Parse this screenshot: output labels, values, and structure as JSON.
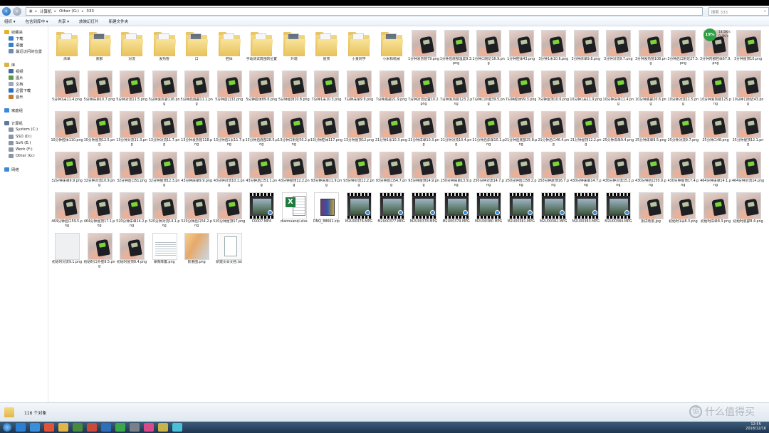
{
  "address": {
    "crumbs": [
      "计算机",
      "Other (G:)",
      "333"
    ]
  },
  "search": {
    "placeholder": "搜索 333"
  },
  "toolbar": {
    "items": [
      "组织 ▾",
      "包含到库中 ▾",
      "共享 ▾",
      "放映幻灯片",
      "新建文件夹"
    ]
  },
  "sidebar": {
    "items": [
      {
        "label": "收藏夹",
        "icon": "star-icon",
        "indent": 0
      },
      {
        "label": "下载",
        "icon": "download-icon",
        "indent": 1
      },
      {
        "label": "桌面",
        "icon": "desktop-icon",
        "indent": 1
      },
      {
        "label": "最近访问的位置",
        "icon": "recent-icon",
        "indent": 1
      },
      {
        "label": "",
        "icon": "",
        "indent": 0
      },
      {
        "label": "库",
        "icon": "library-icon",
        "indent": 0
      },
      {
        "label": "视频",
        "icon": "video-icon",
        "indent": 1
      },
      {
        "label": "图片",
        "icon": "picture-icon",
        "indent": 1
      },
      {
        "label": "文档",
        "icon": "document-icon",
        "indent": 1
      },
      {
        "label": "迅雷下载",
        "icon": "thunder-icon",
        "indent": 1
      },
      {
        "label": "音乐",
        "icon": "music-icon",
        "indent": 1
      },
      {
        "label": "",
        "icon": "",
        "indent": 0
      },
      {
        "label": "家庭组",
        "icon": "homegroup-icon",
        "indent": 0
      },
      {
        "label": "",
        "icon": "",
        "indent": 0
      },
      {
        "label": "计算机",
        "icon": "computer-icon",
        "indent": 0
      },
      {
        "label": "System (C:)",
        "icon": "drive-icon",
        "indent": 1
      },
      {
        "label": "SSD (D:)",
        "icon": "drive-icon",
        "indent": 1
      },
      {
        "label": "Soft (E:)",
        "icon": "drive-icon",
        "indent": 1
      },
      {
        "label": "Work (F:)",
        "icon": "drive-icon",
        "indent": 1
      },
      {
        "label": "Other (G:)",
        "icon": "drive-icon",
        "indent": 1
      },
      {
        "label": "",
        "icon": "",
        "indent": 0
      },
      {
        "label": "网络",
        "icon": "network-icon",
        "indent": 0
      }
    ]
  },
  "files": [
    {
      "label": "床单",
      "kind": "folder"
    },
    {
      "label": "底部",
      "kind": "folder"
    },
    {
      "label": "对流",
      "kind": "folder"
    },
    {
      "label": "发热管",
      "kind": "folder"
    },
    {
      "label": "口",
      "kind": "folder"
    },
    {
      "label": "腔体",
      "kind": "folder"
    },
    {
      "label": "手动测试周围的位置",
      "kind": "folder"
    },
    {
      "label": "外观",
      "kind": "folder"
    },
    {
      "label": "屋顶",
      "kind": "folder"
    },
    {
      "label": "小爱同学",
      "kind": "folder"
    },
    {
      "label": "小米和机械",
      "kind": "folder"
    },
    {
      "label": "1分钟发热管79.png",
      "kind": "photo"
    },
    {
      "label": "1分钟后底部温度9.3.png",
      "kind": "photo"
    },
    {
      "label": "1分钟口附近16.9.png",
      "kind": "photo"
    },
    {
      "label": "1分钟腔体43.png",
      "kind": "photo"
    },
    {
      "label": "3分钟1米10.6.png",
      "kind": "photo"
    },
    {
      "label": "3分钟床单9.8.png",
      "kind": "photo"
    },
    {
      "label": "3分钟对流9.7.png",
      "kind": "photo"
    },
    {
      "label": "3分钟发热管108.png",
      "kind": "photo"
    },
    {
      "label": "3分钟后口附近27.5.png",
      "kind": "photo"
    },
    {
      "label": "3分钟内部腔体67.9.png",
      "kind": "photo"
    },
    {
      "label": "3分钟屋顶10.png",
      "kind": "photo"
    },
    {
      "label": "5分钟1米11.4.png",
      "kind": "photo"
    },
    {
      "label": "5分钟床单10.7.png",
      "kind": "photo"
    },
    {
      "label": "5分钟对流11.5.png",
      "kind": "photo"
    },
    {
      "label": "5分钟发热管116.png",
      "kind": "photo"
    },
    {
      "label": "5分钟后底部11.1.png",
      "kind": "photo"
    },
    {
      "label": "5分钟后口32.png",
      "kind": "photo"
    },
    {
      "label": "5分钟腔体89.6.png",
      "kind": "photo"
    },
    {
      "label": "5分钟屋顶10.8.png",
      "kind": "photo"
    },
    {
      "label": "7分钟1米10.3.png",
      "kind": "photo"
    },
    {
      "label": "7分钟床单9.9.png",
      "kind": "photo"
    },
    {
      "label": "7分钟底部21.9.png",
      "kind": "photo"
    },
    {
      "label": "7分钟对流位置10.2.png",
      "kind": "photo"
    },
    {
      "label": "7分钟发热管123.2.png",
      "kind": "photo"
    },
    {
      "label": "7分钟口外壁39.5.png",
      "kind": "photo"
    },
    {
      "label": "7分钟腔体99.3.png",
      "kind": "photo"
    },
    {
      "label": "7分钟屋顶10.6.png",
      "kind": "photo"
    },
    {
      "label": "10分钟1米11.9.png",
      "kind": "photo"
    },
    {
      "label": "10分钟床单11.4.png",
      "kind": "photo"
    },
    {
      "label": "10分钟底部20.6.png",
      "kind": "photo"
    },
    {
      "label": "10分钟对流11.5.png",
      "kind": "photo"
    },
    {
      "label": "10分钟发热管125.png",
      "kind": "photo"
    },
    {
      "label": "10分钟口附近43.png",
      "kind": "photo"
    },
    {
      "label": "10分钟腔体110.png",
      "kind": "photo"
    },
    {
      "label": "10分钟屋顶12.5.png",
      "kind": "photo"
    },
    {
      "label": "13分钟对流11.3.png",
      "kind": "photo"
    },
    {
      "label": "13分钟对流11.7.png",
      "kind": "photo"
    },
    {
      "label": "13分钟发热管118.png",
      "kind": "photo"
    },
    {
      "label": "13分钟后1米11.7.png",
      "kind": "photo"
    },
    {
      "label": "13分钟后底部28.5.png",
      "kind": "photo"
    },
    {
      "label": "13分钟口附近50.2.png",
      "kind": "photo"
    },
    {
      "label": "13分钟腔体117.png",
      "kind": "photo"
    },
    {
      "label": "13分钟屋顶12.png",
      "kind": "photo"
    },
    {
      "label": "21分钟1米10.3.png",
      "kind": "photo"
    },
    {
      "label": "21分钟床单10.3.png",
      "kind": "photo"
    },
    {
      "label": "21分钟对流10.4.png",
      "kind": "photo"
    },
    {
      "label": "21分钟后床单10.1.png",
      "kind": "photo"
    },
    {
      "label": "21分钟后底部25.8.png",
      "kind": "photo"
    },
    {
      "label": "21分钟后口46.4.png",
      "kind": "photo"
    },
    {
      "label": "21分钟屋顶12.2.png",
      "kind": "photo"
    },
    {
      "label": "25分钟床单9.4.png",
      "kind": "photo"
    },
    {
      "label": "25分钟床单9.5.png",
      "kind": "photo"
    },
    {
      "label": "25分钟对流9.7.png",
      "kind": "photo"
    },
    {
      "label": "25分钟口48.png",
      "kind": "photo"
    },
    {
      "label": "25分钟屋顶12.1.png",
      "kind": "photo"
    },
    {
      "label": "32分钟床单9.9.png",
      "kind": "photo"
    },
    {
      "label": "32分钟对流10.9.png",
      "kind": "photo"
    },
    {
      "label": "32分钟后口51.png",
      "kind": "photo"
    },
    {
      "label": "32分钟屋顶12.3.png",
      "kind": "photo"
    },
    {
      "label": "43分钟床单9.9.png",
      "kind": "photo"
    },
    {
      "label": "43分钟对流10.1.png",
      "kind": "photo"
    },
    {
      "label": "43分钟后口51.1.png",
      "kind": "photo"
    },
    {
      "label": "43分钟屋顶12.2.png",
      "kind": "photo"
    },
    {
      "label": "93分钟床单11.9.png",
      "kind": "photo"
    },
    {
      "label": "93分钟对流12.2.png",
      "kind": "photo"
    },
    {
      "label": "93分钟后口54.7.png",
      "kind": "photo"
    },
    {
      "label": "93分钟屋顶14.9.png",
      "kind": "photo"
    },
    {
      "label": "250分钟床单13.9.png",
      "kind": "photo"
    },
    {
      "label": "250分钟对流14.7.png",
      "kind": "photo"
    },
    {
      "label": "250分钟后口58.2.png",
      "kind": "photo"
    },
    {
      "label": "250分钟屋顶16.7.png",
      "kind": "photo"
    },
    {
      "label": "430分钟床单14.7.png",
      "kind": "photo"
    },
    {
      "label": "430分钟对流15.2.png",
      "kind": "photo"
    },
    {
      "label": "430分钟后口50.9.png",
      "kind": "photo"
    },
    {
      "label": "430分钟屋顶17.4.png",
      "kind": "photo"
    },
    {
      "label": "464分钟床单14.1.png",
      "kind": "photo"
    },
    {
      "label": "464分钟对流14.png",
      "kind": "photo"
    },
    {
      "label": "464分钟后口59.5.png",
      "kind": "photo"
    },
    {
      "label": "464分钟屋顶17.1.png",
      "kind": "photo"
    },
    {
      "label": "520分钟床单14.2.png",
      "kind": "photo"
    },
    {
      "label": "520分钟对流14.1.png",
      "kind": "photo"
    },
    {
      "label": "520分钟后口54.2.png",
      "kind": "photo"
    },
    {
      "label": "520分钟屋顶17.png",
      "kind": "photo"
    },
    {
      "label": "C0007.MP4",
      "kind": "video"
    },
    {
      "label": "diannuanqi.xlsx",
      "kind": "xls"
    },
    {
      "label": "DNQ_88661.zip",
      "kind": "zip"
    },
    {
      "label": "M2U00376.MPG",
      "kind": "video"
    },
    {
      "label": "M2U00377.MPG",
      "kind": "video"
    },
    {
      "label": "M2U00378.MPG",
      "kind": "video"
    },
    {
      "label": "M2U00379.MPG",
      "kind": "video"
    },
    {
      "label": "M2U00380.MPG",
      "kind": "video"
    },
    {
      "label": "M2U00381.MPG",
      "kind": "video"
    },
    {
      "label": "M2U00382.MPG",
      "kind": "video"
    },
    {
      "label": "M2U00383.MPG",
      "kind": "video"
    },
    {
      "label": "M2U00384.MPG",
      "kind": "video"
    },
    {
      "label": "测试场景.jpg",
      "kind": "photo"
    },
    {
      "label": "初始时1米8.3.png",
      "kind": "photo"
    },
    {
      "label": "初始时床单8.3.png",
      "kind": "photo"
    },
    {
      "label": "初始时底部8.4.png",
      "kind": "photo"
    },
    {
      "label": "初始时对流9.1.png",
      "kind": "white"
    },
    {
      "label": "初始时口外壁8.5.png",
      "kind": "photo"
    },
    {
      "label": "初始时屋顶8.4.png",
      "kind": "photo"
    },
    {
      "label": "录像阵置.png",
      "kind": "plain"
    },
    {
      "label": "影重图.png",
      "kind": "colorful"
    },
    {
      "label": "新建文本文档.txt",
      "kind": "txt"
    }
  ],
  "status": {
    "count": "116 个对象"
  },
  "netwidget": {
    "percent": "19%",
    "up": "14.5K/s",
    "down": "0.4K/s"
  },
  "watermark": {
    "logo": "值",
    "text": "什么值得买"
  },
  "clock": {
    "time": "12:55",
    "date": "2018/12/16"
  },
  "colors": {
    "taskbar": "#1d3550",
    "folder": "#e1b54a",
    "accent": "#2a8de0"
  }
}
